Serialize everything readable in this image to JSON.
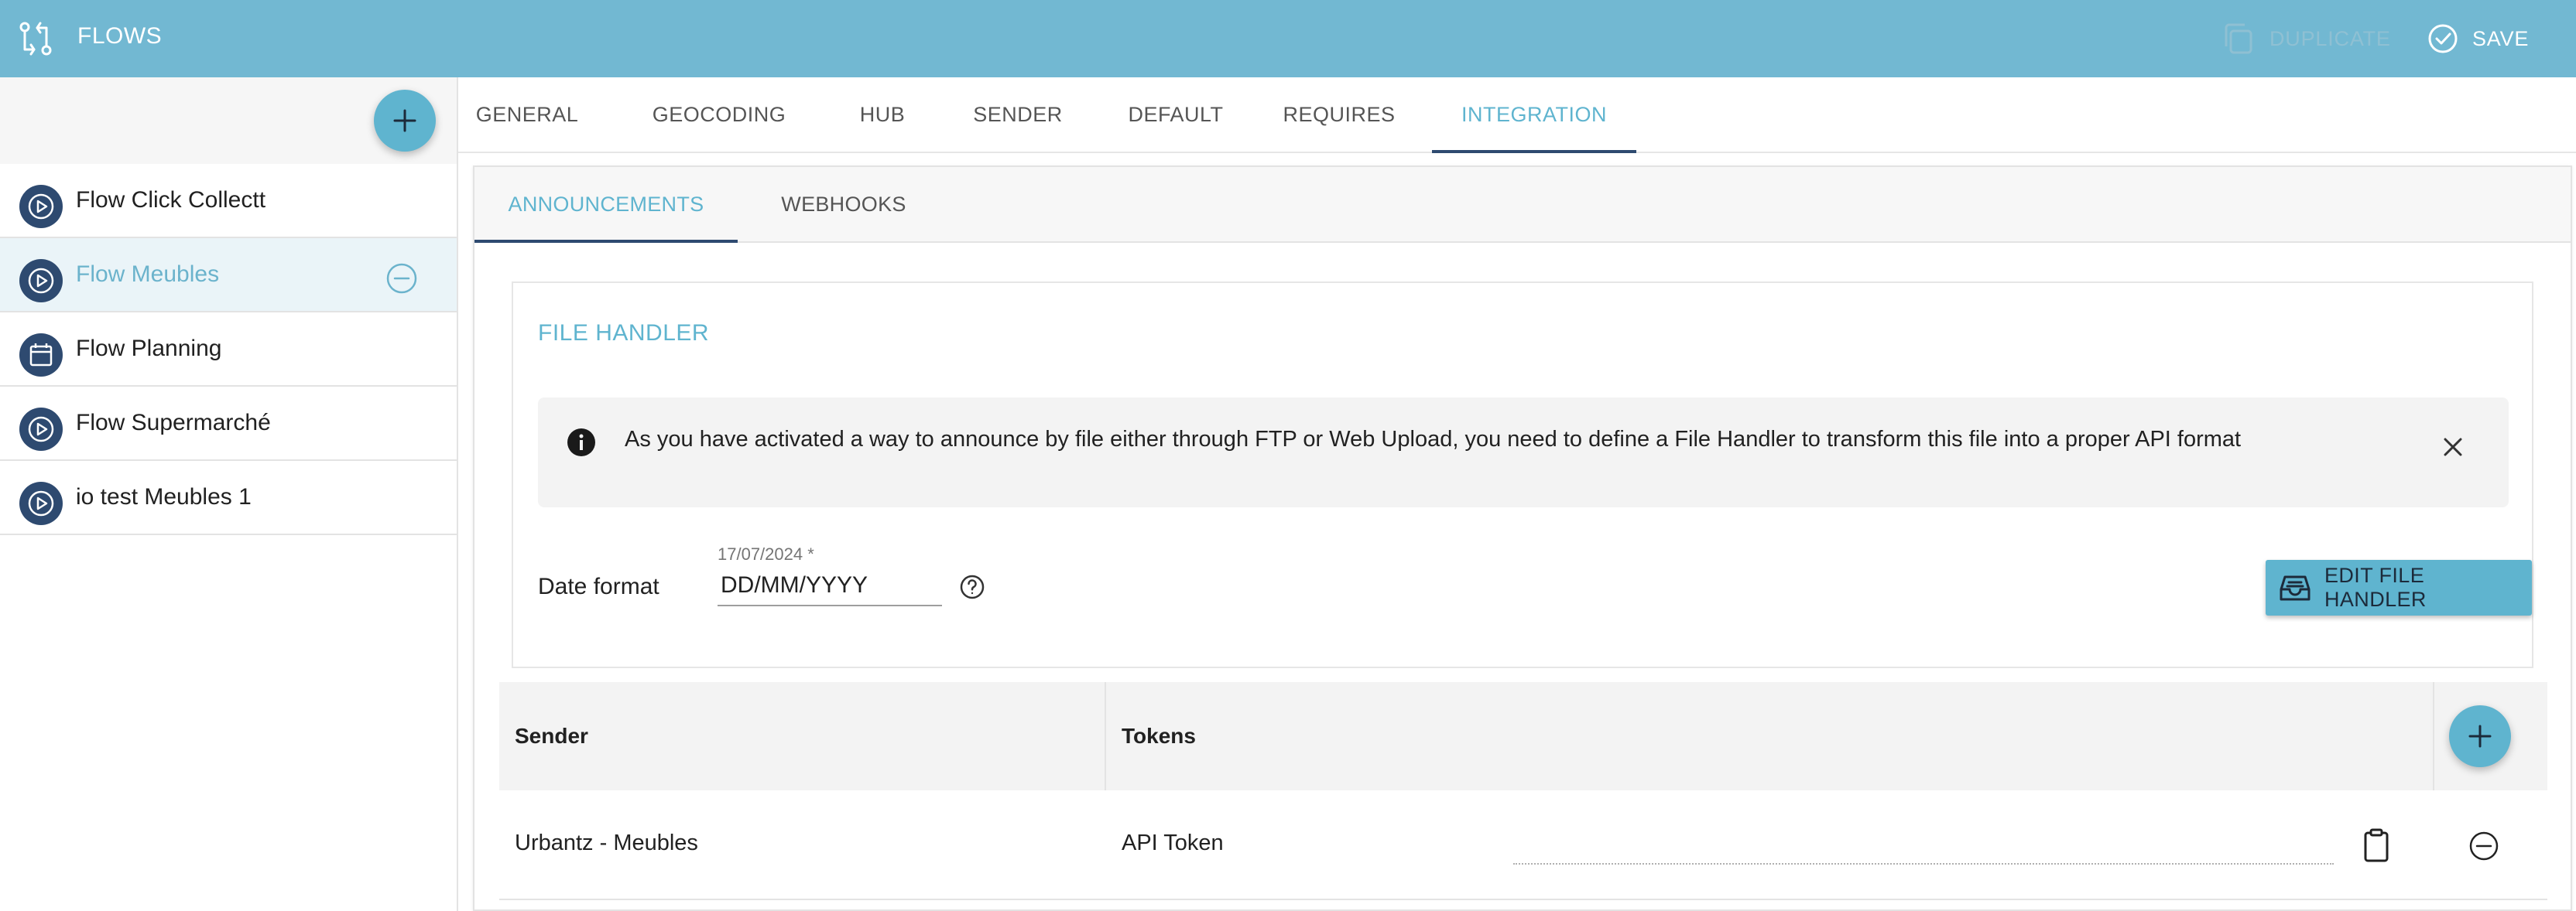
{
  "app": {
    "title": "FLOWS"
  },
  "toolbar": {
    "duplicate_label": "DUPLICATE",
    "save_label": "SAVE"
  },
  "sidebar": {
    "items": [
      {
        "label": "Flow Click Collectt",
        "icon": "play-icon",
        "active": false
      },
      {
        "label": "Flow Meubles",
        "icon": "play-icon",
        "active": true
      },
      {
        "label": "Flow Planning",
        "icon": "calendar-icon",
        "active": false
      },
      {
        "label": "Flow Supermarché",
        "icon": "play-icon",
        "active": false
      },
      {
        "label": "io test Meubles 1",
        "icon": "play-icon",
        "active": false
      }
    ]
  },
  "tabs": [
    {
      "label": "GENERAL"
    },
    {
      "label": "GEOCODING"
    },
    {
      "label": "HUB"
    },
    {
      "label": "SENDER"
    },
    {
      "label": "DEFAULT"
    },
    {
      "label": "REQUIRES"
    },
    {
      "label": "INTEGRATION",
      "active": true
    }
  ],
  "subtabs": [
    {
      "label": "ANNOUNCEMENTS",
      "active": true
    },
    {
      "label": "WEBHOOKS"
    }
  ],
  "file_handler": {
    "title": "FILE HANDLER",
    "info": "As you have activated a way to announce by file either through FTP or Web Upload, you need to define a File Handler to transform this file into a proper API format",
    "date_format_label": "Date format",
    "date_format_hint": "17/07/2024 *",
    "date_format_value": "DD/MM/YYYY",
    "edit_button": "EDIT FILE HANDLER"
  },
  "table": {
    "headers": {
      "sender": "Sender",
      "tokens": "Tokens"
    },
    "rows": [
      {
        "sender": "Urbantz - Meubles",
        "token_type": "API Token"
      }
    ]
  },
  "colors": {
    "appbar": "#72b8d2",
    "accent": "#5fb4cf",
    "navy": "#2e4a70"
  }
}
